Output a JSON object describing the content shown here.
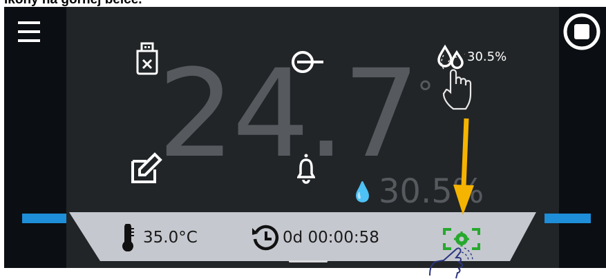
{
  "caption": "ikony na górnej belce.",
  "display": {
    "big_temperature": "24.7",
    "big_degree": "°",
    "big_humidity": "30.5%",
    "top_humidity": "30.5%"
  },
  "bottom_bar": {
    "set_temperature": "35.0°C",
    "timer": "0d 00:00:58"
  },
  "colors": {
    "screen_bg": "#0d1014",
    "main_bg": "#222528",
    "panel_bg": "#c5c8cf",
    "accent_blue": "#1e8ed8",
    "status_green": "#27a82d",
    "arrow_yellow": "#f5b400",
    "hand_outline": "#2a3580"
  },
  "icons": {
    "menu": "hamburger-icon",
    "stop": "stop-icon",
    "usb": "usb-drive-icon",
    "login": "login-icon",
    "humidity": "humidity-drops-icon",
    "edit": "edit-icon",
    "alarm": "bell-icon",
    "thermometer": "thermometer-icon",
    "timer": "clock-icon",
    "status": "fan-status-icon"
  }
}
